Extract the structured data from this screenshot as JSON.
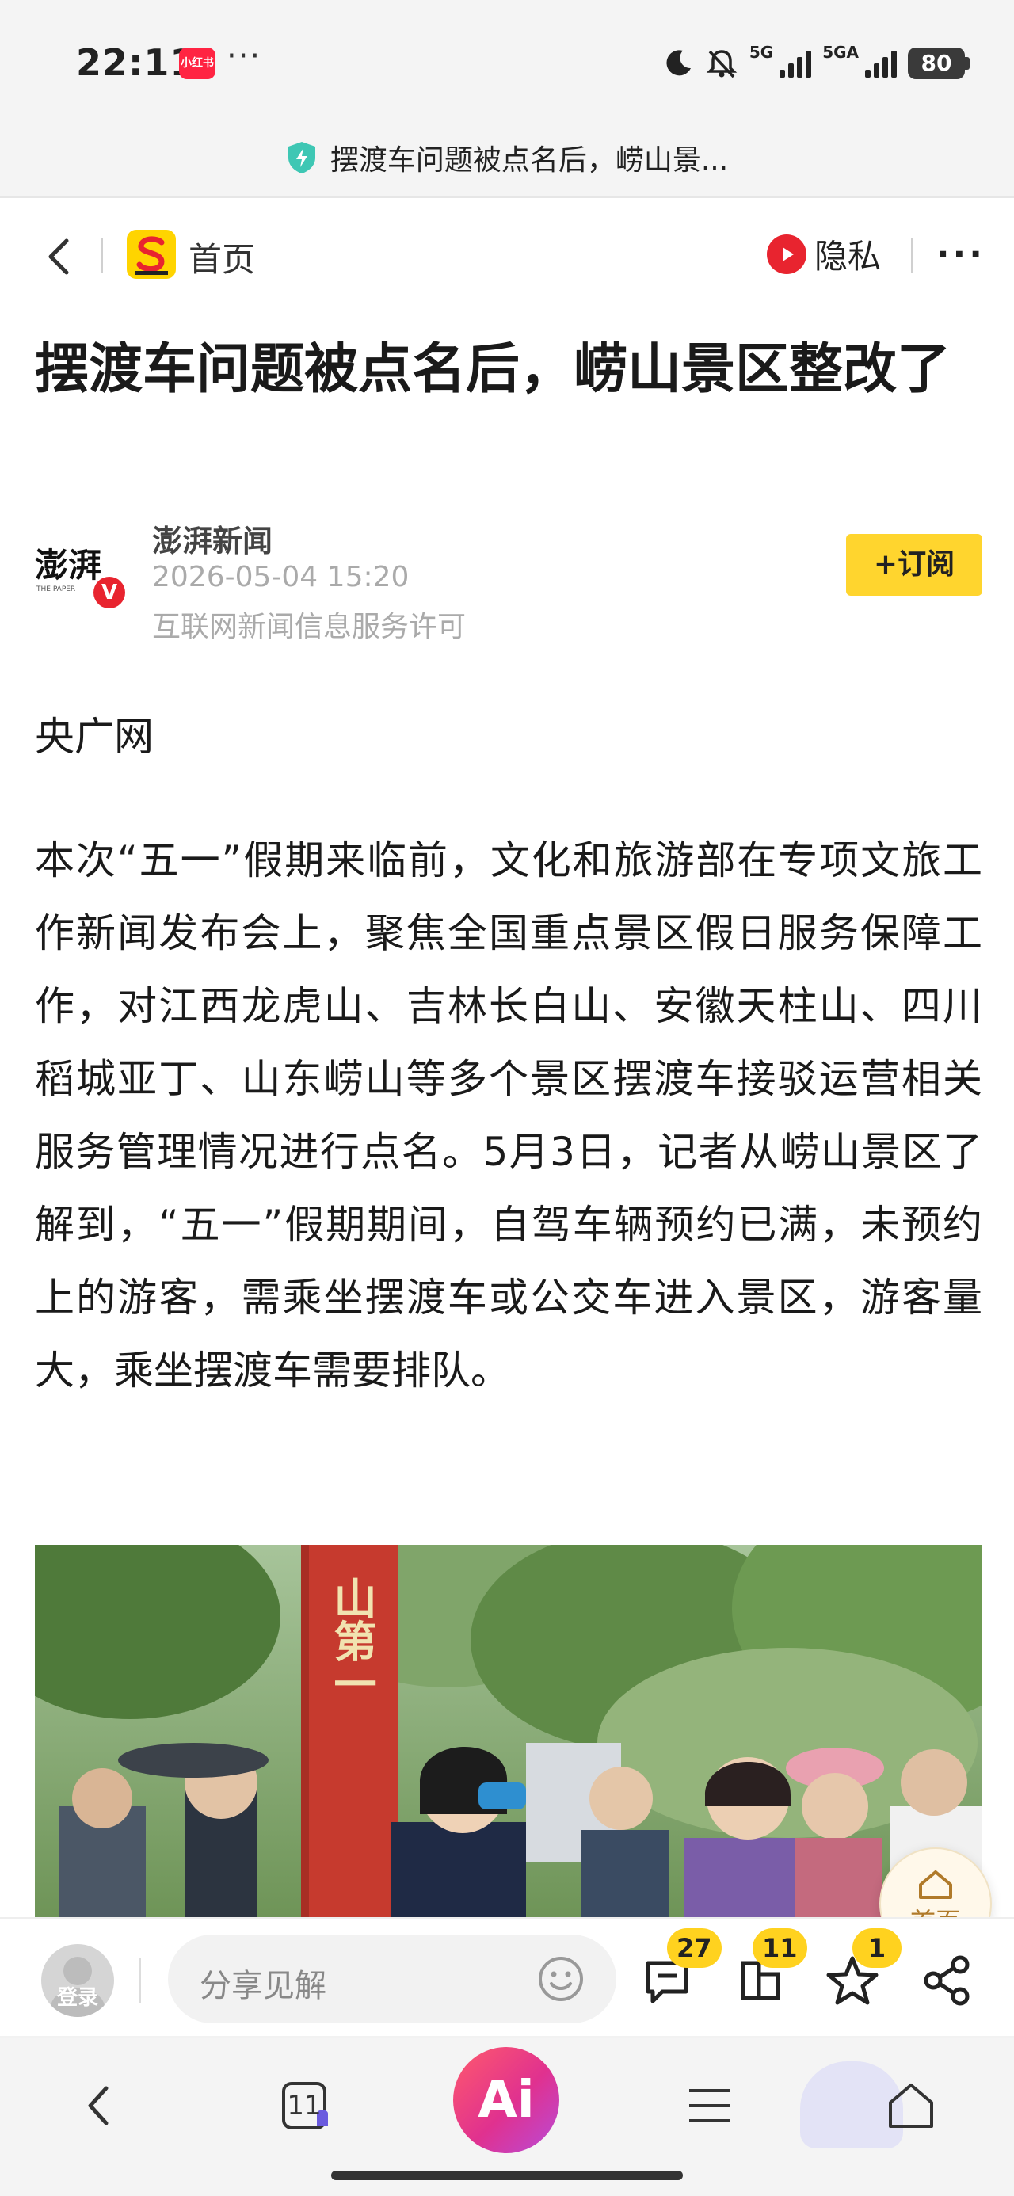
{
  "status_bar": {
    "time": "22:11",
    "app_badge": "小红书",
    "more": "···",
    "network_1": "5G",
    "network_2": "5GA",
    "battery": "80"
  },
  "browser": {
    "page_title": "摆渡车问题被点名后，崂山景..."
  },
  "site_header": {
    "home_label": "首页",
    "privacy_label": "隐私",
    "more_label": "···"
  },
  "article": {
    "title": "摆渡车问题被点名后，崂山景区整改了",
    "author": {
      "name": "澎湃新闻",
      "date": "2026-05-04 15:20",
      "license": "互联网新闻信息服务许可",
      "logo_text": "澎湃",
      "logo_subtext": "THE PAPER",
      "verified": "V"
    },
    "subscribe_label": "+订阅",
    "source": "央广网",
    "body": "本次“五一”假期来临前，文化和旅游部在专项文旅工作新闻发布会上，聚焦全国重点景区假日服务保障工作，对江西龙虎山、吉林长白山、安徽天柱山、四川稻城亚丁、山东崂山等多个景区摆渡车接驳运营相关服务管理情况进行点名。5月3日，记者从崂山景区了解到，“五一”假期期间，自驾车辆预约已满，未预约上的游客，需乘坐摆渡车或公交车进入景区，游客量大，乘坐摆渡车需要排队。",
    "photo_pillar_text": "山第一"
  },
  "floating_home": {
    "label": "首页"
  },
  "comment_bar": {
    "login_label": "登录",
    "placeholder": "分享见解",
    "comments_count": "27",
    "favorites_count": "11",
    "likes_count": "1"
  },
  "nav_bar": {
    "tabs_count": "11",
    "ai_label": "Ai"
  },
  "colors": {
    "accent_yellow": "#ffd52e",
    "brand_red": "#e8242f",
    "ai_gradient_start": "#ff5a6c",
    "ai_gradient_end": "#b84bd9"
  }
}
